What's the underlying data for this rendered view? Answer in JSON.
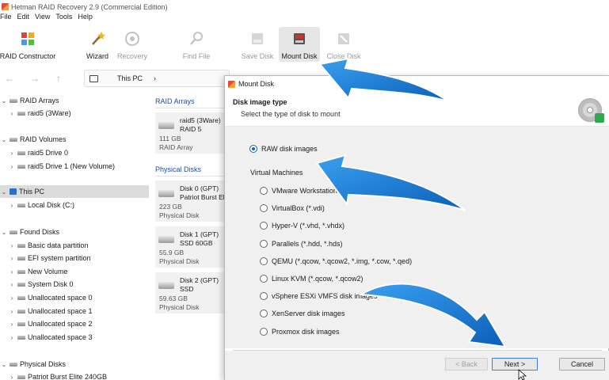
{
  "app": {
    "title": "Hetman RAID Recovery 2.9 (Commercial Edition)"
  },
  "menu": [
    "File",
    "Edit",
    "View",
    "Tools",
    "Help"
  ],
  "toolbar": {
    "raid_constructor": "RAID Constructor",
    "wizard": "Wizard",
    "recovery": "Recovery",
    "find_file": "Find File",
    "save_disk": "Save Disk",
    "mount_disk": "Mount Disk",
    "close_disk": "Close Disk"
  },
  "address": {
    "crumb": "This PC",
    "chevron": "›"
  },
  "tree": {
    "raid_arrays": "RAID Arrays",
    "raid5_3ware": "raid5 (3Ware)",
    "raid_volumes": "RAID Volumes",
    "raid5_drive0": "raid5 Drive 0",
    "raid5_drive1": "raid5 Drive 1 (New Volume)",
    "this_pc": "This PC",
    "local_disk": "Local Disk (C:)",
    "found_disks": "Found Disks",
    "basic_data": "Basic data partition",
    "efi": "EFI system partition",
    "new_volume": "New Volume",
    "system_disk0": "System Disk 0",
    "unalloc0": "Unallocated space 0",
    "unalloc1": "Unallocated space 1",
    "unalloc2": "Unallocated space 2",
    "unalloc3": "Unallocated space 3",
    "physical_disks": "Physical Disks",
    "patriot": "Patriot Burst Elite 240GB"
  },
  "panel": {
    "raid_arrays": "RAID Arrays",
    "physical_disks": "Physical Disks",
    "cards": [
      {
        "line1": "raid5 (3Ware)",
        "line2": "RAID 5",
        "line3": "111 GB",
        "line4": "RAID Array"
      },
      {
        "line1": "Disk 0 (GPT)",
        "line2": "Patriot Burst Elite",
        "line3": "223 GB",
        "line4": "Physical Disk"
      },
      {
        "line1": "Disk 1 (GPT)",
        "line2": "SSD 60GB",
        "line3": "55.9 GB",
        "line4": "Physical Disk"
      },
      {
        "line1": "Disk 2 (GPT)",
        "line2": "SSD",
        "line3": "59.63 GB",
        "line4": "Physical Disk"
      }
    ]
  },
  "dialog": {
    "title": "Mount Disk",
    "heading": "Disk image type",
    "subheading": "Select the type of disk to mount",
    "raw": "RAW disk images",
    "group": "Virtual Machines",
    "options": [
      "VMware Workstation / V",
      "VirtualBox (*.vdi)",
      "Hyper-V (*.vhd, *.vhdx)",
      "Parallels (*.hdd, *.hds)",
      "QEMU (*.qcow, *.qcow2, *.img, *.cow, *.qed)",
      "Linux KVM (*.qcow, *.qcow2)",
      "vSphere ESXi VMFS disk images",
      "XenServer disk images",
      "Proxmox disk images"
    ],
    "back": "< Back",
    "next": "Next >",
    "cancel": "Cancel"
  },
  "colors": {
    "accent": "#1565c0",
    "arrow": "#1e7fd8",
    "section": "#1f4e9c"
  },
  "icons": [
    "raid-constructor-icon",
    "wizard-icon",
    "recovery-icon",
    "find-file-icon",
    "save-disk-icon",
    "mount-disk-icon",
    "close-disk-icon",
    "cd-disk-icon"
  ]
}
